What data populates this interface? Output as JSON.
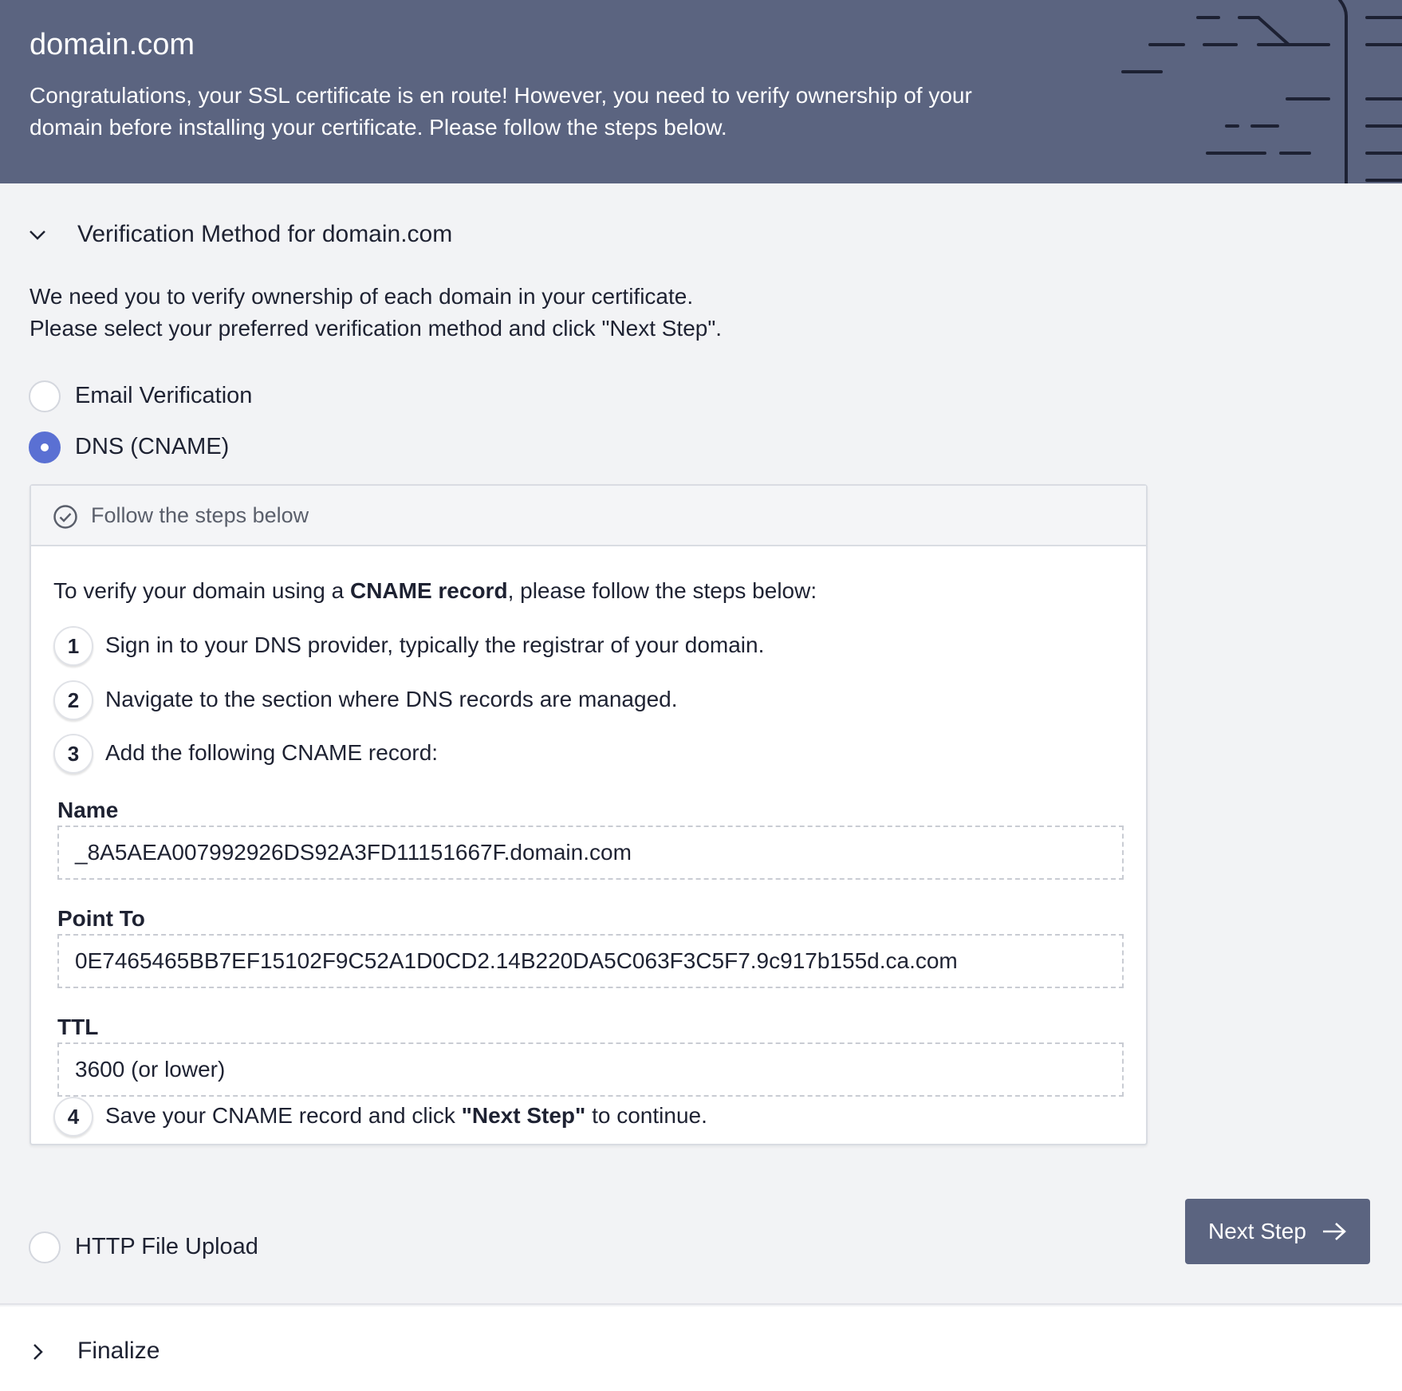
{
  "banner": {
    "title": "domain.com",
    "message": "Congratulations, your SSL certificate is en route! However, you need to verify ownership of your domain before installing your certificate. Please follow the steps below."
  },
  "verification": {
    "heading": "Verification Method for domain.com",
    "intro_line1": "We need you to verify ownership of each domain in your certificate.",
    "intro_line2": "Please select your preferred verification method and click \"Next Step\".",
    "options": [
      {
        "label": "Email Verification",
        "selected": false
      },
      {
        "label": "DNS (CNAME)",
        "selected": true
      },
      {
        "label": "HTTP File Upload",
        "selected": false
      }
    ]
  },
  "panel": {
    "title": "Follow the steps below",
    "instruction_prefix": "To verify your domain using a ",
    "instruction_bold": "CNAME record",
    "instruction_suffix": ", please follow the steps below:",
    "steps": [
      {
        "num": "1",
        "text": "Sign in to your DNS provider, typically the registrar of your domain."
      },
      {
        "num": "2",
        "text": "Navigate to the section where DNS records are managed."
      },
      {
        "num": "3",
        "text": "Add the following CNAME record:"
      },
      {
        "num": "4",
        "text_prefix": "Save your CNAME record and click ",
        "text_bold": "\"Next Step\"",
        "text_suffix": " to continue."
      }
    ],
    "fields": {
      "name_label": "Name",
      "name_value": "_8A5AEA007992926DS92A3FD11151667F.domain.com",
      "point_label": "Point To",
      "point_value": "0E7465465BB7EF15102F9C52A1D0CD2.14B220DA5C063F3C5F7.9c917b155d.ca.com",
      "ttl_label": "TTL",
      "ttl_value": "3600 (or lower)"
    }
  },
  "next_button": {
    "label": "Next Step",
    "icon": "arrow-right-icon"
  },
  "finalize": {
    "label": "Finalize"
  },
  "colors": {
    "banner": "#5b6480",
    "accent": "#5a70d3",
    "button": "#5b6480"
  }
}
